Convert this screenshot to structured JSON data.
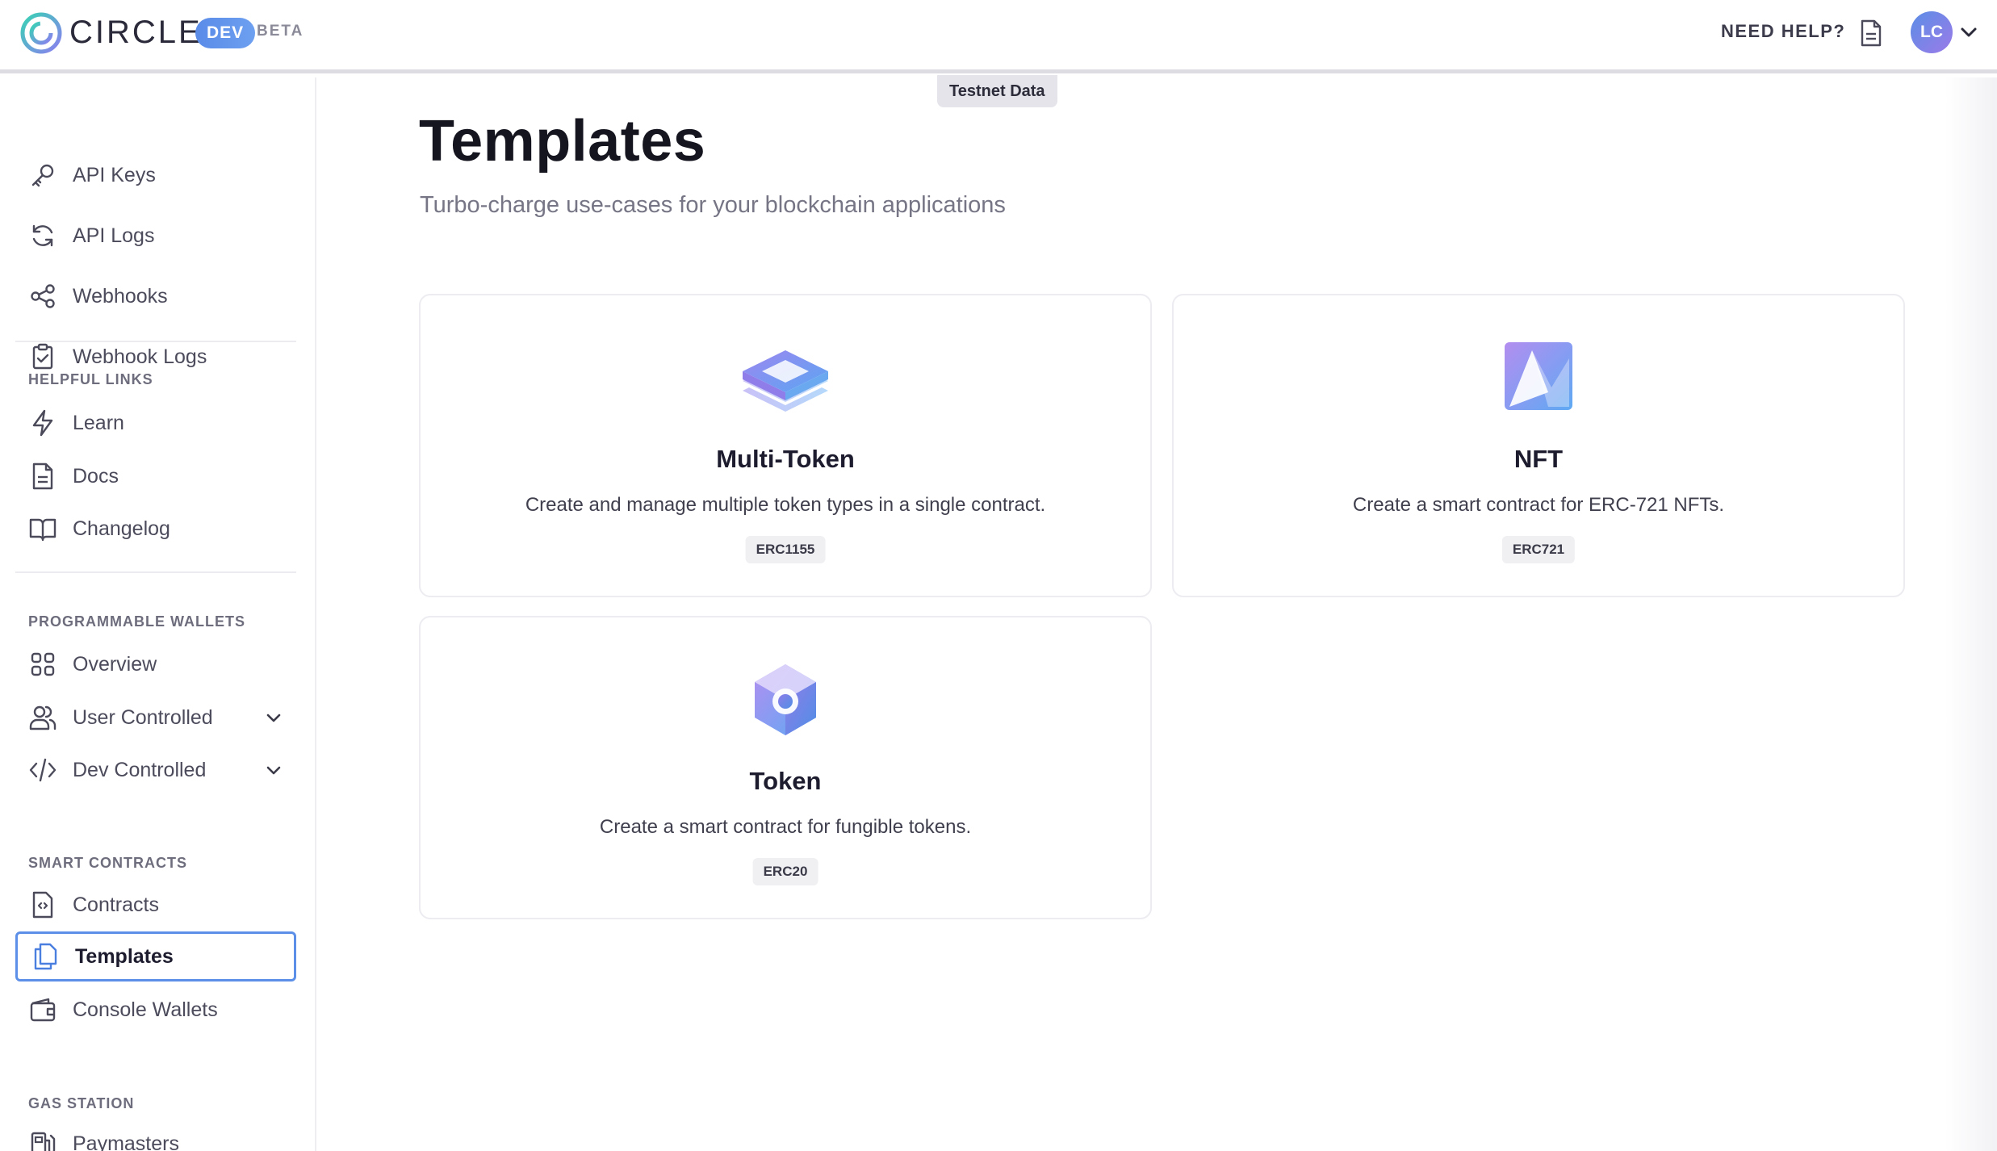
{
  "header": {
    "brand": "CIRCLE",
    "env_badge": "DEV",
    "beta": "BETA",
    "need_help": "NEED HELP?",
    "avatar_initials": "LC"
  },
  "sidebar": {
    "top_items": [
      {
        "label": "API Keys",
        "icon": "key-icon"
      },
      {
        "label": "API Logs",
        "icon": "refresh-icon"
      },
      {
        "label": "Webhooks",
        "icon": "share-icon"
      },
      {
        "label": "Webhook Logs",
        "icon": "clipboard-check-icon"
      }
    ],
    "sections": {
      "helpful_links": {
        "title": "HELPFUL LINKS",
        "items": [
          {
            "label": "Learn",
            "icon": "bolt-icon"
          },
          {
            "label": "Docs",
            "icon": "document-icon"
          },
          {
            "label": "Changelog",
            "icon": "book-icon"
          }
        ]
      },
      "programmable_wallets": {
        "title": "PROGRAMMABLE WALLETS",
        "items": [
          {
            "label": "Overview",
            "icon": "grid-icon"
          },
          {
            "label": "User Controlled",
            "icon": "users-icon"
          },
          {
            "label": "Dev Controlled",
            "icon": "code-icon"
          }
        ]
      },
      "smart_contracts": {
        "title": "SMART CONTRACTS",
        "items": [
          {
            "label": "Contracts",
            "icon": "contract-icon"
          },
          {
            "label": "Templates",
            "icon": "templates-icon"
          },
          {
            "label": "Console Wallets",
            "icon": "wallet-icon"
          }
        ]
      },
      "gas_station": {
        "title": "GAS STATION",
        "items": [
          {
            "label": "Paymasters",
            "icon": "gas-pump-icon"
          }
        ]
      }
    },
    "active_item": "Templates"
  },
  "main": {
    "testnet_label": "Testnet Data",
    "title": "Templates",
    "subtitle": "Turbo-charge use-cases for your blockchain applications",
    "cards": [
      {
        "title": "Multi-Token",
        "description": "Create and manage multiple token types in a single contract.",
        "badge": "ERC1155",
        "icon": "layers-icon"
      },
      {
        "title": "NFT",
        "description": "Create a smart contract for ERC-721 NFTs.",
        "badge": "ERC721",
        "icon": "nft-icon"
      },
      {
        "title": "Token",
        "description": "Create a smart contract for fungible tokens.",
        "badge": "ERC20",
        "icon": "token-cube-icon"
      }
    ]
  },
  "colors": {
    "accent": "#5b8fe8",
    "brand_gradient_start": "#5a8be8",
    "brand_gradient_end": "#9b7ae8"
  }
}
